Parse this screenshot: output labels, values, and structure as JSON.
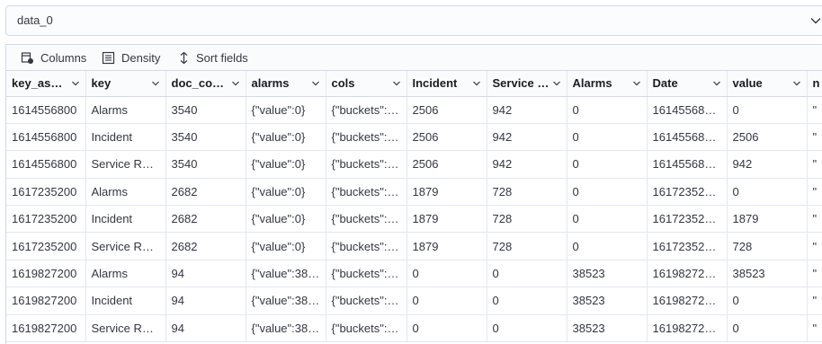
{
  "selector": {
    "value": "data_0"
  },
  "toolbar": {
    "columns_label": "Columns",
    "density_label": "Density",
    "sort_label": "Sort fields"
  },
  "table": {
    "headers": [
      "key_as_…",
      "key",
      "doc_cou…",
      "alarms",
      "cols",
      "Incident",
      "Service …",
      "Alarms",
      "Date",
      "value",
      "n"
    ],
    "rows": [
      [
        "1614556800",
        "Alarms",
        "3540",
        "{\"value\":0}",
        "{\"buckets\":…",
        "2506",
        "942",
        "0",
        "161455680…",
        "0",
        "\""
      ],
      [
        "1614556800",
        "Incident",
        "3540",
        "{\"value\":0}",
        "{\"buckets\":…",
        "2506",
        "942",
        "0",
        "161455680…",
        "2506",
        "\""
      ],
      [
        "1614556800",
        "Service Re…",
        "3540",
        "{\"value\":0}",
        "{\"buckets\":…",
        "2506",
        "942",
        "0",
        "161455680…",
        "942",
        "\""
      ],
      [
        "1617235200",
        "Alarms",
        "2682",
        "{\"value\":0}",
        "{\"buckets\":…",
        "1879",
        "728",
        "0",
        "161723520…",
        "0",
        "\""
      ],
      [
        "1617235200",
        "Incident",
        "2682",
        "{\"value\":0}",
        "{\"buckets\":…",
        "1879",
        "728",
        "0",
        "161723520…",
        "1879",
        "\""
      ],
      [
        "1617235200",
        "Service Re…",
        "2682",
        "{\"value\":0}",
        "{\"buckets\":…",
        "1879",
        "728",
        "0",
        "161723520…",
        "728",
        "\""
      ],
      [
        "1619827200",
        "Alarms",
        "94",
        "{\"value\":38…",
        "{\"buckets\":…",
        "0",
        "0",
        "38523",
        "161982720…",
        "38523",
        "\""
      ],
      [
        "1619827200",
        "Incident",
        "94",
        "{\"value\":38…",
        "{\"buckets\":…",
        "0",
        "0",
        "38523",
        "161982720…",
        "0",
        "\""
      ],
      [
        "1619827200",
        "Service Re…",
        "94",
        "{\"value\":38…",
        "{\"buckets\":…",
        "0",
        "0",
        "38523",
        "161982720…",
        "0",
        "\""
      ]
    ]
  },
  "icons": {
    "selector_chevron": "chevron-down-icon",
    "columns": "columns-icon",
    "density": "density-icon",
    "sort": "sort-icon",
    "header_chevron": "chevron-down-icon"
  }
}
